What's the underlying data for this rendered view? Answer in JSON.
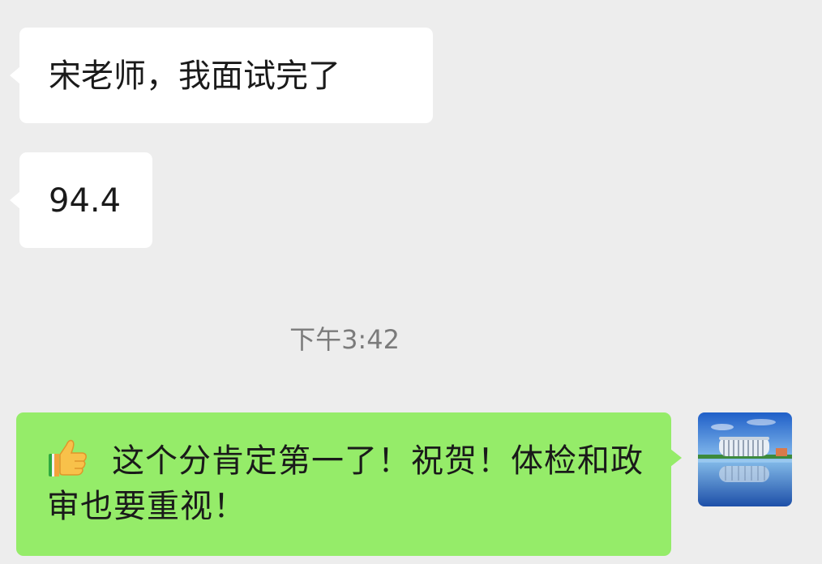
{
  "chat": {
    "messages": [
      {
        "direction": "incoming",
        "text": "宋老师，我面试完了"
      },
      {
        "direction": "incoming",
        "text": "94.4"
      },
      {
        "direction": "outgoing",
        "emoji": "thumbs-up-icon",
        "text": "这个分肯定第一了！祝贺！体检和政审也要重视！"
      }
    ],
    "timestamp": "下午3:42"
  },
  "colors": {
    "background": "#ededed",
    "incoming_bubble": "#ffffff",
    "outgoing_bubble": "#95ec69",
    "timestamp_text": "#7b7b7b"
  }
}
